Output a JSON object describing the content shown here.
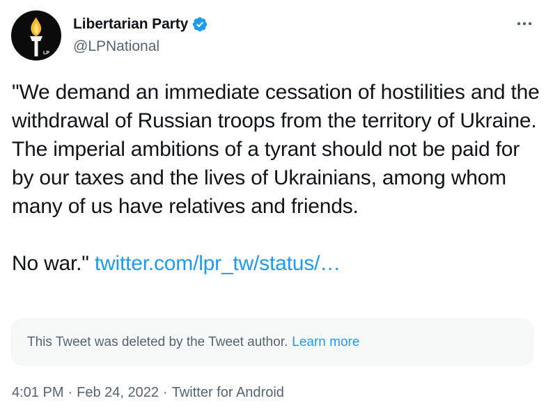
{
  "author": {
    "display_name": "Libertarian Party",
    "handle": "@LPNational",
    "avatar_icon": "torch-logo-icon",
    "avatar_text": "LP",
    "verified_icon": "verified-badge-icon",
    "verified_color": "#1d9bf0"
  },
  "more_icon": "more-dots-icon",
  "tweet": {
    "paragraph_1": "\"We demand an immediate cessation of hostilities and the withdrawal of Russian troops from the territory of Ukraine. The imperial ambitions of a tyrant should not be paid for by our taxes and the lives of Ukrainians, among whom many of us have relatives and friends.",
    "paragraph_2": "No war.\"",
    "link_text": "twitter.com/lpr_tw/status/…"
  },
  "quote": {
    "deleted_text": "This Tweet was deleted by the Tweet author.",
    "learn_more": "Learn more"
  },
  "meta": {
    "time": "4:01 PM",
    "separator_1": "·",
    "date": "Feb 24, 2022",
    "separator_2": "·",
    "source": "Twitter for Android"
  },
  "colors": {
    "link": "#1d9bf0",
    "secondary_text": "#536471",
    "primary_text": "#0f1419"
  }
}
